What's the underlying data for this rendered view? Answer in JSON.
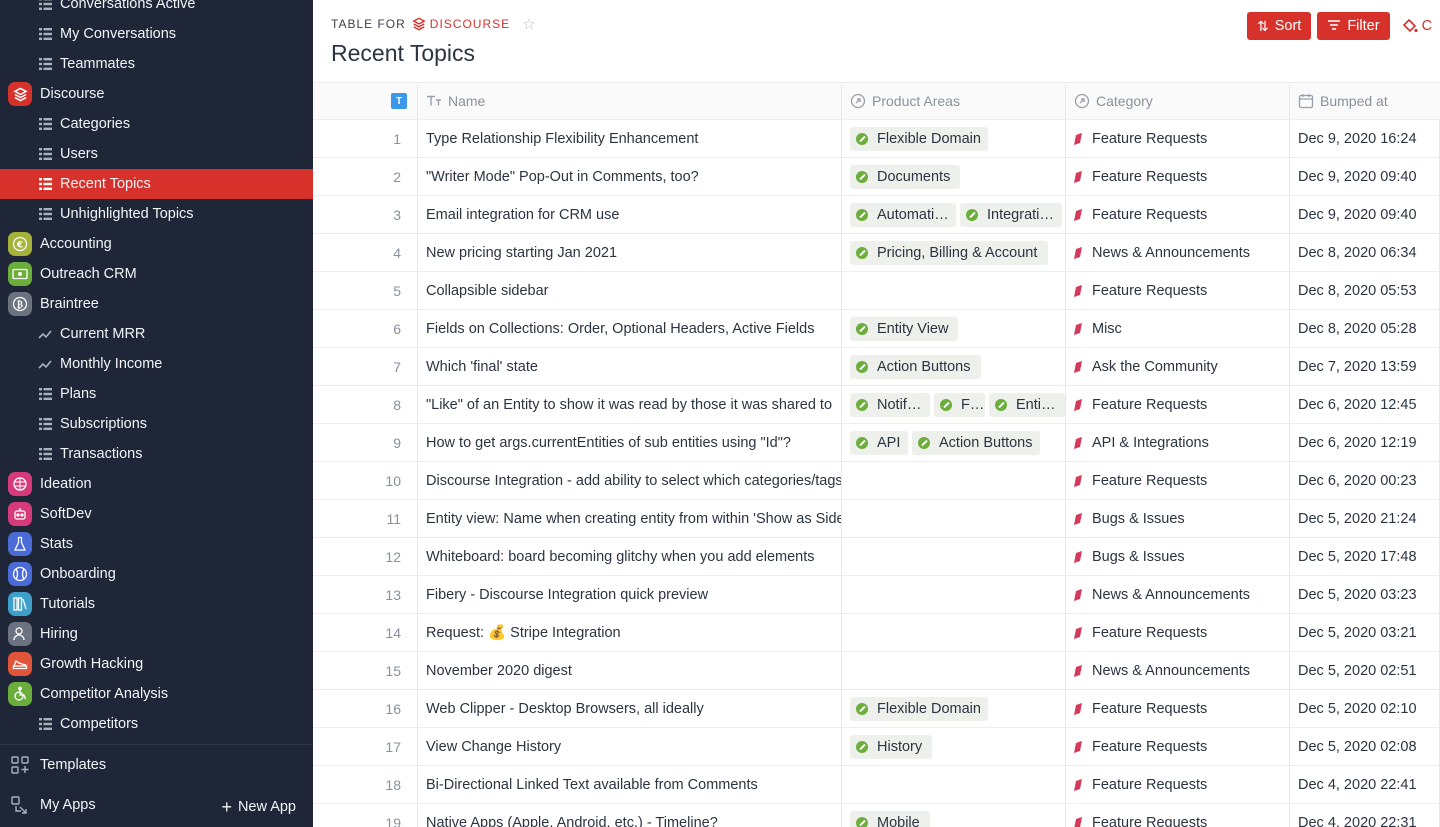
{
  "sidebar": {
    "items": [
      {
        "type": "sub",
        "label": "Conversations Active",
        "icon": "grid-icon"
      },
      {
        "type": "sub",
        "label": "My Conversations",
        "icon": "grid-icon"
      },
      {
        "type": "sub",
        "label": "Teammates",
        "icon": "grid-icon"
      },
      {
        "type": "app",
        "label": "Discourse",
        "icon": "discourse-icon",
        "color": "#d6312b"
      },
      {
        "type": "sub",
        "label": "Categories",
        "icon": "grid-icon"
      },
      {
        "type": "sub",
        "label": "Users",
        "icon": "grid-icon"
      },
      {
        "type": "sub",
        "label": "Recent Topics",
        "icon": "grid-icon",
        "active": true
      },
      {
        "type": "sub",
        "label": "Unhighlighted Topics",
        "icon": "grid-icon"
      },
      {
        "type": "app",
        "label": "Accounting",
        "icon": "euro-icon",
        "color": "#a4b23a"
      },
      {
        "type": "app",
        "label": "Outreach CRM",
        "icon": "cash-icon",
        "color": "#6cae3c"
      },
      {
        "type": "app",
        "label": "Braintree",
        "icon": "bitcoin-icon",
        "color": "#6b7280"
      },
      {
        "type": "sub",
        "label": "Current MRR",
        "icon": "trend-icon"
      },
      {
        "type": "sub",
        "label": "Monthly Income",
        "icon": "trend-icon"
      },
      {
        "type": "sub",
        "label": "Plans",
        "icon": "grid-icon"
      },
      {
        "type": "sub",
        "label": "Subscriptions",
        "icon": "grid-icon"
      },
      {
        "type": "sub",
        "label": "Transactions",
        "icon": "grid-icon"
      },
      {
        "type": "app",
        "label": "Ideation",
        "icon": "brain-icon",
        "color": "#d63a7b"
      },
      {
        "type": "app",
        "label": "SoftDev",
        "icon": "robot-icon",
        "color": "#d63a7b"
      },
      {
        "type": "app",
        "label": "Stats",
        "icon": "flask-icon",
        "color": "#4b6bd6"
      },
      {
        "type": "app",
        "label": "Onboarding",
        "icon": "ball-icon",
        "color": "#4b6bd6"
      },
      {
        "type": "app",
        "label": "Tutorials",
        "icon": "books-icon",
        "color": "#3ea0c8"
      },
      {
        "type": "app",
        "label": "Hiring",
        "icon": "person-icon",
        "color": "#6b7280"
      },
      {
        "type": "app",
        "label": "Growth Hacking",
        "icon": "sneaker-icon",
        "color": "#e0553a"
      },
      {
        "type": "app",
        "label": "Competitor Analysis",
        "icon": "wheelchair-icon",
        "color": "#6cae3c"
      },
      {
        "type": "sub",
        "label": "Competitors",
        "icon": "grid-icon"
      }
    ],
    "footer": {
      "templates_label": "Templates",
      "my_apps_label": "My Apps",
      "new_app_label": "New App"
    }
  },
  "header": {
    "crumb_prefix": "TABLE FOR",
    "crumb_app": "DISCOURSE",
    "title": "Recent Topics",
    "sort_label": "Sort",
    "filter_label": "Filter",
    "more_label": "C"
  },
  "table": {
    "columns": {
      "name": "Name",
      "areas": "Product Areas",
      "category": "Category",
      "bumped": "Bumped at"
    },
    "rows": [
      {
        "n": "1",
        "name": "Type Relationship Flexibility Enhancement",
        "areas": [
          {
            "t": "Flexible Domain",
            "w": 138
          }
        ],
        "cat": "Feature Requests",
        "date": "Dec 9, 2020 16:24"
      },
      {
        "n": "2",
        "name": "\"Writer Mode\" Pop-Out in Comments, too?",
        "areas": [
          {
            "t": "Documents",
            "w": 110
          }
        ],
        "cat": "Feature Requests",
        "date": "Dec 9, 2020 09:40"
      },
      {
        "n": "3",
        "name": "Email integration for CRM use",
        "areas": [
          {
            "t": "Automati…",
            "w": 106
          },
          {
            "t": "Integrati…",
            "w": 102
          }
        ],
        "cat": "Feature Requests",
        "date": "Dec 9, 2020 09:40"
      },
      {
        "n": "4",
        "name": "New pricing starting Jan 2021",
        "areas": [
          {
            "t": "Pricing, Billing & Account",
            "w": 198
          }
        ],
        "cat": "News & Announcements",
        "date": "Dec 8, 2020 06:34"
      },
      {
        "n": "5",
        "name": "Collapsible sidebar",
        "areas": [],
        "cat": "Feature Requests",
        "date": "Dec 8, 2020 05:53"
      },
      {
        "n": "6",
        "name": "Fields on Collections: Order, Optional Headers, Active Fields",
        "areas": [
          {
            "t": "Entity View",
            "w": 108
          }
        ],
        "cat": "Misc",
        "date": "Dec 8, 2020 05:28"
      },
      {
        "n": "7",
        "name": "Which 'final' state",
        "areas": [
          {
            "t": "Action Buttons",
            "w": 131
          }
        ],
        "cat": "Ask the Community",
        "date": "Dec 7, 2020 13:59"
      },
      {
        "n": "8",
        "name": "\"Like\" of an Entity to show it was read by those it was shared to",
        "areas": [
          {
            "t": "Notif…",
            "w": 80
          },
          {
            "t": "F…",
            "w": 51
          },
          {
            "t": "Enti…",
            "w": 76
          }
        ],
        "cat": "Feature Requests",
        "date": "Dec 6, 2020 12:45"
      },
      {
        "n": "9",
        "name": "How to get args.currentEntities of sub entities using \"Id\"?",
        "areas": [
          {
            "t": "API",
            "w": 58
          },
          {
            "t": "Action Buttons",
            "w": 128
          }
        ],
        "cat": "API & Integrations",
        "date": "Dec 6, 2020 12:19"
      },
      {
        "n": "10",
        "name": "Discourse Integration - add ability to select which categories/tags",
        "areas": [],
        "cat": "Feature Requests",
        "date": "Dec 6, 2020 00:23"
      },
      {
        "n": "11",
        "name": "Entity view: Name when creating entity from within 'Show as Side",
        "areas": [],
        "cat": "Bugs & Issues",
        "date": "Dec 5, 2020 21:24"
      },
      {
        "n": "12",
        "name": "Whiteboard: board becoming glitchy when you add elements",
        "areas": [],
        "cat": "Bugs & Issues",
        "date": "Dec 5, 2020 17:48"
      },
      {
        "n": "13",
        "name": "Fibery - Discourse Integration quick preview",
        "areas": [],
        "cat": "News & Announcements",
        "date": "Dec 5, 2020 03:23"
      },
      {
        "n": "14",
        "name": "Request: 💰 Stripe Integration",
        "areas": [],
        "cat": "Feature Requests",
        "date": "Dec 5, 2020 03:21"
      },
      {
        "n": "15",
        "name": "November 2020 digest",
        "areas": [],
        "cat": "News & Announcements",
        "date": "Dec 5, 2020 02:51"
      },
      {
        "n": "16",
        "name": "Web Clipper - Desktop Browsers, all ideally",
        "areas": [
          {
            "t": "Flexible Domain",
            "w": 138
          }
        ],
        "cat": "Feature Requests",
        "date": "Dec 5, 2020 02:10"
      },
      {
        "n": "17",
        "name": "View Change History",
        "areas": [
          {
            "t": "History",
            "w": 82
          }
        ],
        "cat": "Feature Requests",
        "date": "Dec 5, 2020 02:08"
      },
      {
        "n": "18",
        "name": "Bi-Directional Linked Text available from Comments",
        "areas": [],
        "cat": "Feature Requests",
        "date": "Dec 4, 2020 22:41"
      },
      {
        "n": "19",
        "name": "Native Apps (Apple, Android, etc.) - Timeline?",
        "areas": [
          {
            "t": "Mobile",
            "w": 80
          }
        ],
        "cat": "Feature Requests",
        "date": "Dec 4, 2020 22:31"
      }
    ]
  },
  "colors": {
    "sidebar_bg": "#1e2637",
    "accent": "#d6312b",
    "chip_dot": "#6cae3c"
  }
}
